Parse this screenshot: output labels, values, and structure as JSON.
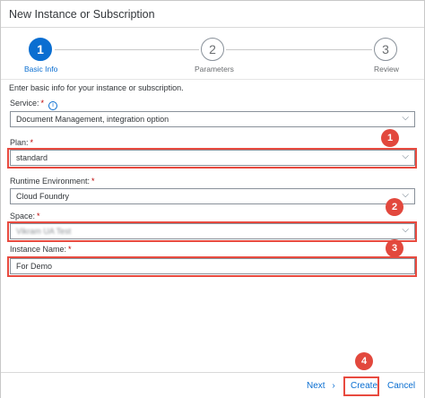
{
  "dialog": {
    "title": "New Instance or Subscription"
  },
  "wizard": {
    "steps": [
      {
        "number": "1",
        "label": "Basic Info",
        "state": "active"
      },
      {
        "number": "2",
        "label": "Parameters",
        "state": "inactive"
      },
      {
        "number": "3",
        "label": "Review",
        "state": "inactive"
      }
    ]
  },
  "form": {
    "intro": "Enter basic info for your instance or subscription.",
    "service": {
      "label": "Service:",
      "required": "*",
      "value": "Document Management, integration option",
      "info_icon": "info-icon"
    },
    "plan": {
      "label": "Plan:",
      "required": "*",
      "value": "standard"
    },
    "runtime": {
      "label": "Runtime Environment:",
      "required": "*",
      "value": "Cloud Foundry"
    },
    "space": {
      "label": "Space:",
      "required": "*",
      "value": "Vikram UA Test"
    },
    "instance_name": {
      "label": "Instance Name:",
      "required": "*",
      "value": "For Demo"
    }
  },
  "annotations": {
    "badge1": "1",
    "badge2": "2",
    "badge3": "3",
    "badge4": "4",
    "color": "#e2483d"
  },
  "footer": {
    "next_label": "Next",
    "next_icon": "›",
    "create_label": "Create",
    "cancel_label": "Cancel"
  },
  "colors": {
    "accent": "#0a6ed1",
    "required": "#bb0000",
    "highlight": "#e84a3f"
  }
}
